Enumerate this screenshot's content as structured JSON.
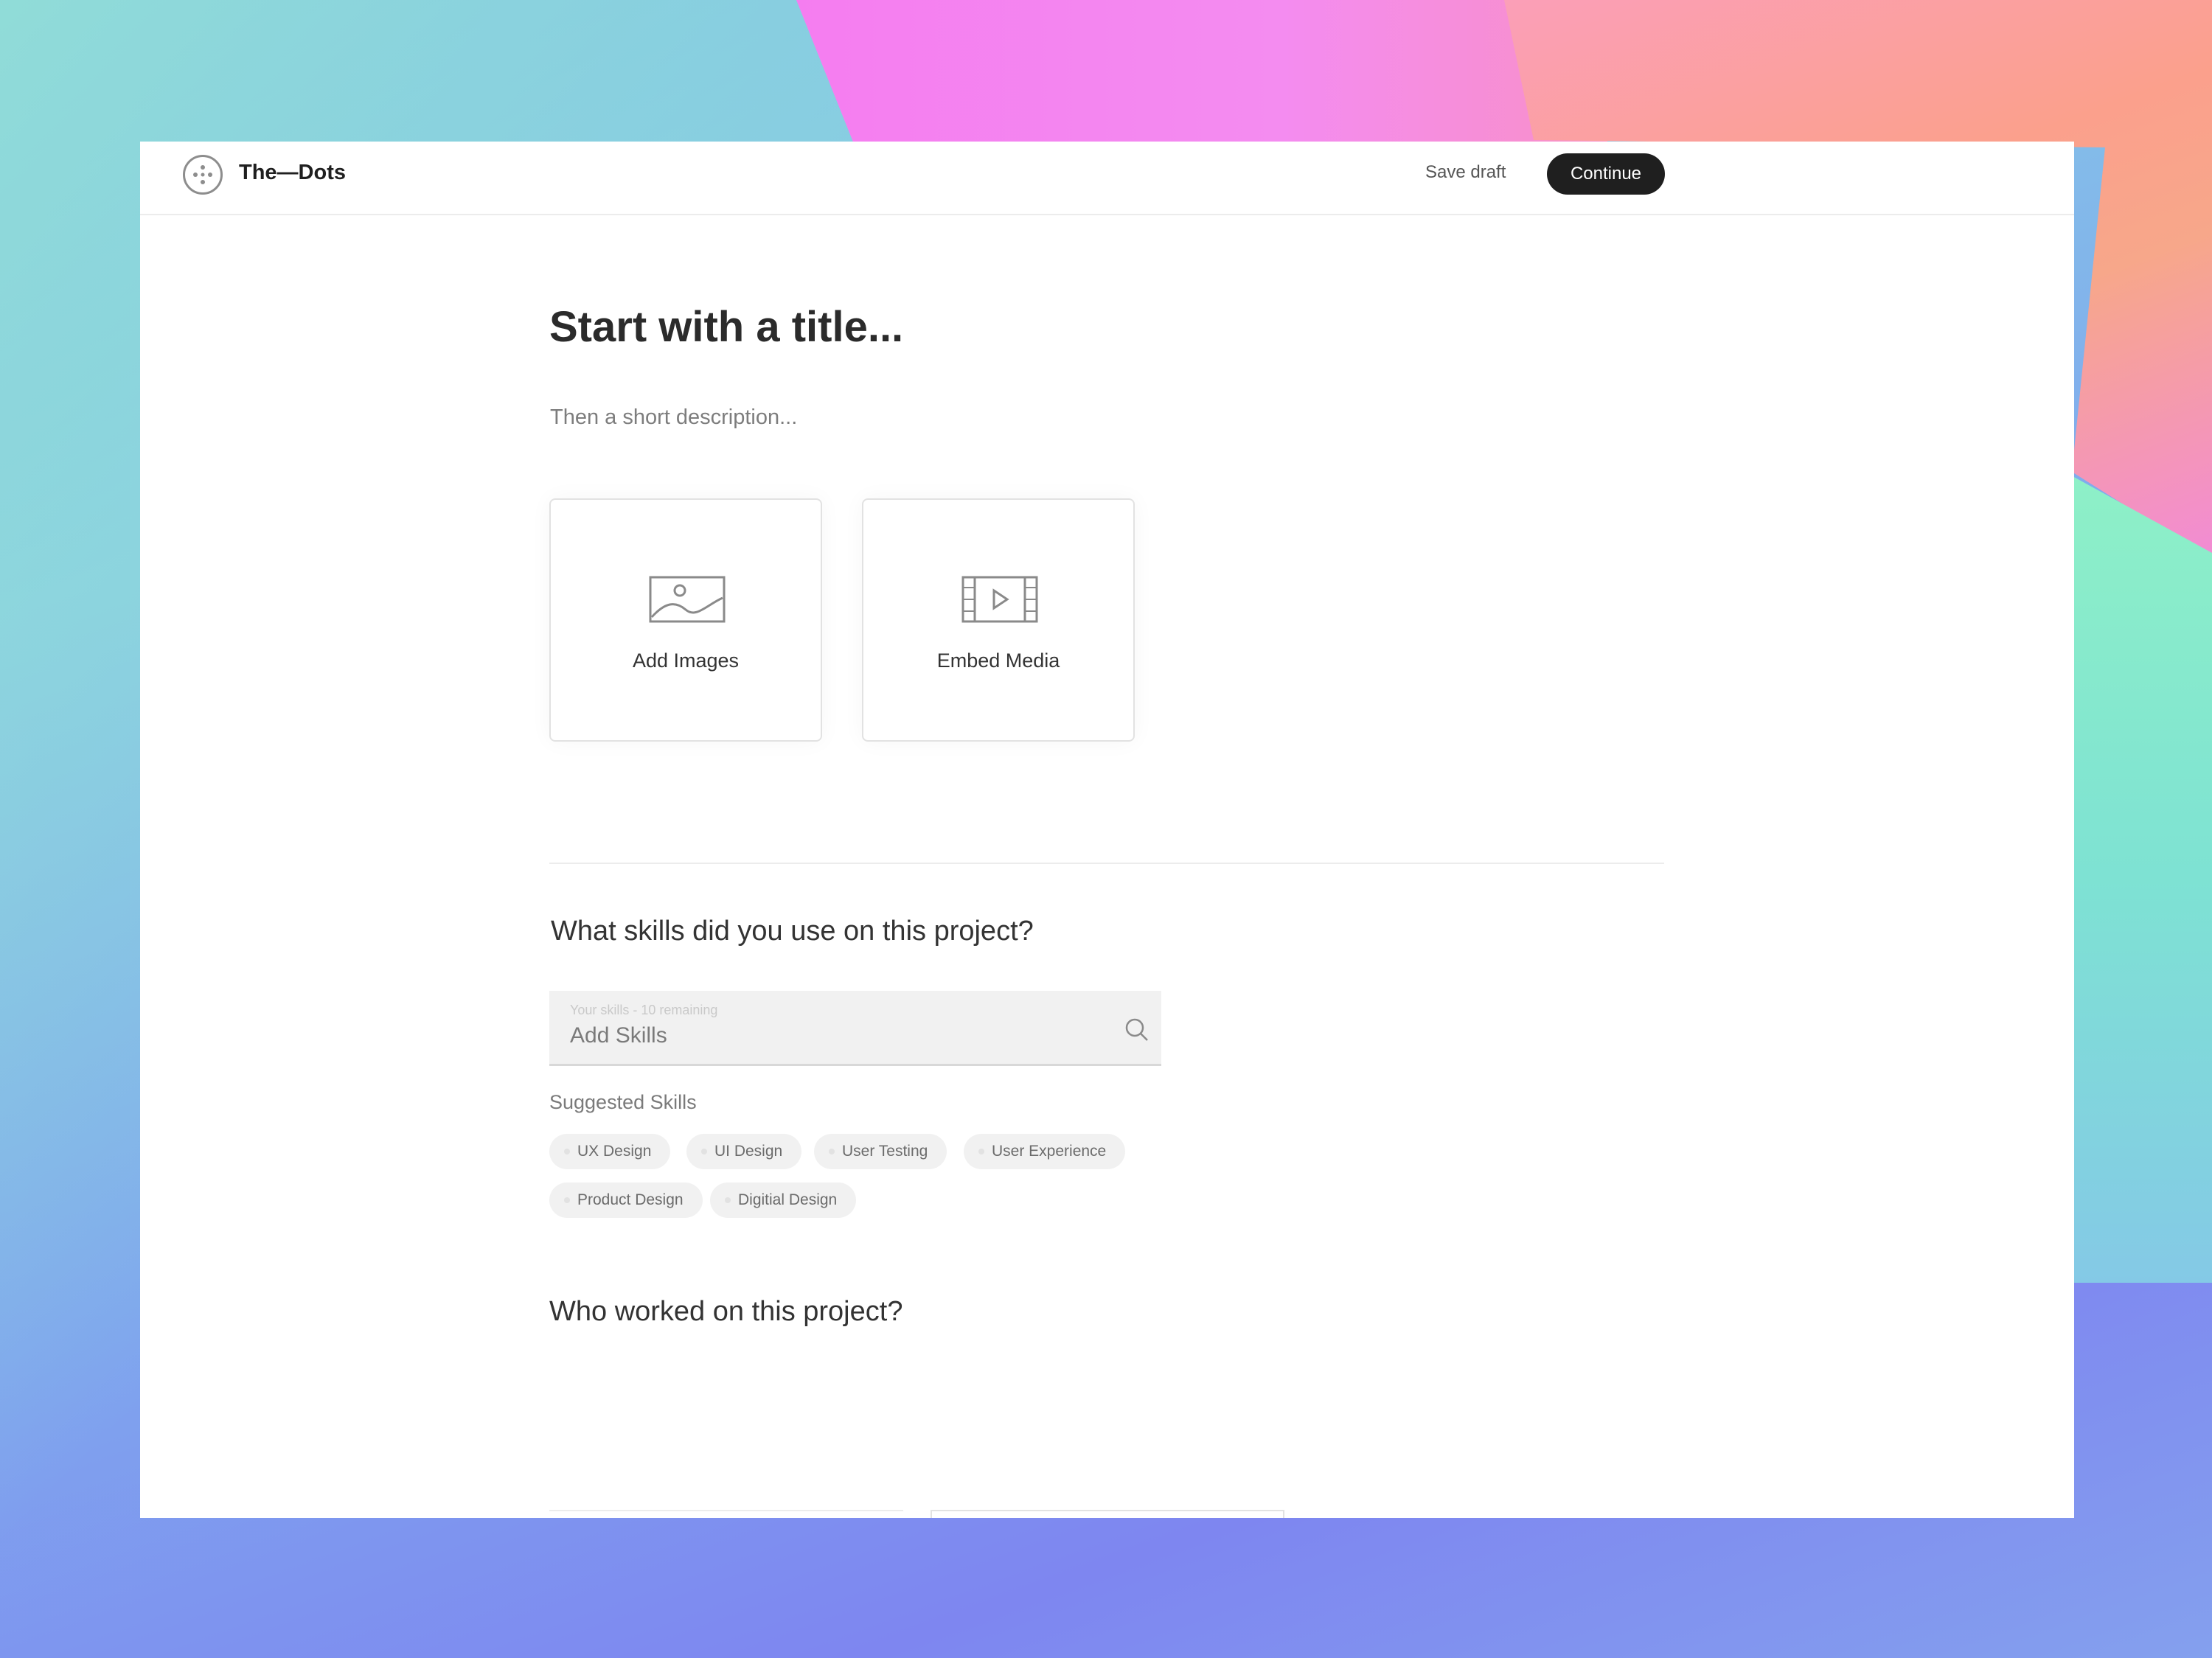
{
  "brand": {
    "name": "The—Dots"
  },
  "header": {
    "save_draft_label": "Save draft",
    "continue_label": "Continue"
  },
  "editor": {
    "title_placeholder": "Start with a title...",
    "description_placeholder": "Then a short description..."
  },
  "media_cards": [
    {
      "label": "Add Images",
      "icon": "image-icon"
    },
    {
      "label": "Embed Media",
      "icon": "video-icon"
    }
  ],
  "skills": {
    "question": "What skills did you use on this project?",
    "input_hint": "Your skills - 10 remaining",
    "input_placeholder": "Add Skills",
    "suggested_label": "Suggested Skills",
    "suggested": [
      "UX Design",
      "UI Design",
      "User Testing",
      "User Experience",
      "Product Design",
      "Digitial Design"
    ]
  },
  "team": {
    "question": "Who worked on this project?",
    "add_icon": "plus-icon",
    "accent": "#e85b7a"
  }
}
